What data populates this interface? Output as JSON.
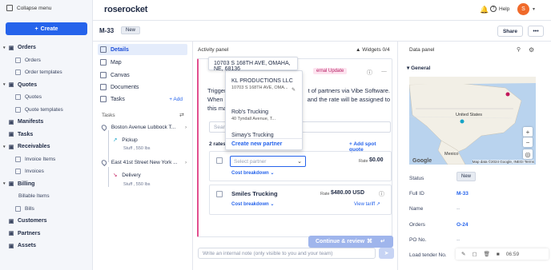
{
  "sidebar": {
    "collapse_label": "Collapse menu",
    "create_label": "Create",
    "items": [
      {
        "label": "Orders",
        "type": "top"
      },
      {
        "label": "Orders",
        "type": "sub"
      },
      {
        "label": "Order templates",
        "type": "sub"
      },
      {
        "label": "Quotes",
        "type": "top"
      },
      {
        "label": "Quotes",
        "type": "sub"
      },
      {
        "label": "Quote templates",
        "type": "sub"
      },
      {
        "label": "Manifests",
        "type": "top"
      },
      {
        "label": "Tasks",
        "type": "top"
      },
      {
        "label": "Receivables",
        "type": "top"
      },
      {
        "label": "Invoice Items",
        "type": "sub"
      },
      {
        "label": "Invoices",
        "type": "sub"
      },
      {
        "label": "Billing",
        "type": "top"
      },
      {
        "label": "Billable Items",
        "type": "plain"
      },
      {
        "label": "Bills",
        "type": "sub"
      },
      {
        "label": "Customers",
        "type": "top"
      },
      {
        "label": "Partners",
        "type": "top"
      },
      {
        "label": "Assets",
        "type": "top"
      }
    ]
  },
  "header": {
    "logo": "roserocket",
    "help_label": "Help",
    "avatar_initial": "S"
  },
  "subheader": {
    "shipment_id": "M-33",
    "status_badge": "New",
    "share_label": "Share",
    "more_label": "•••"
  },
  "detail_nav": {
    "items": [
      "Details",
      "Map",
      "Canvas",
      "Documents",
      "Tasks"
    ],
    "add_label": "+ Add",
    "tasks_label": "Tasks",
    "stops": [
      {
        "name": "Boston Avenue Lubbock T...",
        "action": "Pickup",
        "stuff": "Stuff , 550 lbs"
      },
      {
        "name": "East 41st Street New York ...",
        "action": "Delivery",
        "stuff": "Stuff , 550 lbs"
      }
    ]
  },
  "activity": {
    "title": "Activity panel",
    "widgets_label": "Widgets 0/4",
    "external_badge": "ernal Update",
    "description_left": "Trigger w",
    "description_right": "t of partners via Vibe Software.",
    "description_left2": "When a p",
    "description_right2": "and the rate will be assigned to",
    "description_left3": "this man",
    "search_placeholder": "Searc",
    "rates_found": "2 rates fo",
    "add_spot_quote": "+ Add spot quote",
    "select_partner_placeholder": "Select partner",
    "rate_label": "Rate",
    "rate1_value": "$0.00",
    "cost_breakdown": "Cost breakdown",
    "carrier2": "Smiles Trucking",
    "rate2_value": "$480.00 USD",
    "view_tariff": "View tariff",
    "continue_label": "Continue & review",
    "note_placeholder": "Write an internal note (only visible to you and your team)"
  },
  "dropdown": {
    "tooltip": "10703 S 168TH AVE, OMAHA, NE, 68136",
    "items": [
      {
        "name": "KL PRODUCTIONS LLC",
        "address": "10703 S 168TH AVE, OMA..."
      },
      {
        "name": "Rob's Trucking",
        "address": "40 Tyndall Avenue, T..."
      },
      {
        "name": "Simay's Trucking",
        "address": ""
      }
    ],
    "create_label": "Create new partner"
  },
  "datapanel": {
    "title": "Data panel",
    "general_label": "General",
    "map_attribution": "Map data ©2024 Google, INEGI  Terms",
    "map_google": "Google",
    "map_labels": [
      "United States",
      "Mexico"
    ],
    "fields": [
      {
        "label": "Status",
        "value": "New"
      },
      {
        "label": "Full ID",
        "value": "M-33"
      },
      {
        "label": "Name",
        "value": "--"
      },
      {
        "label": "Orders",
        "value": "O-24"
      },
      {
        "label": "PO No.",
        "value": "--"
      },
      {
        "label": "Load tender No.",
        "value": ""
      }
    ],
    "recording_time": "06:59"
  },
  "colors": {
    "primary": "#2563eb",
    "accent_pink": "#e24f8f",
    "avatar": "#f06a2a"
  }
}
